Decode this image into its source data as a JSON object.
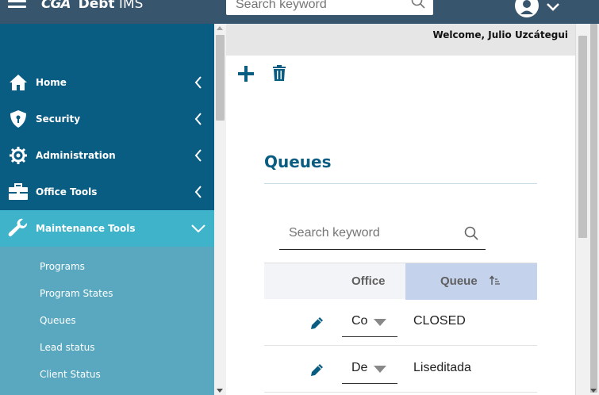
{
  "header": {
    "logo_mark": "CGA",
    "app_name_bold": "Debt",
    "app_name_light": " IMS",
    "search_placeholder": "Search keyword"
  },
  "welcome_text": "Welcome, Julio Uzcátegui",
  "sidebar": {
    "items": [
      {
        "label": "Home",
        "icon": "home-icon"
      },
      {
        "label": "Security",
        "icon": "shield-icon"
      },
      {
        "label": "Administration",
        "icon": "gear-icon"
      },
      {
        "label": "Office Tools",
        "icon": "toolbox-icon"
      },
      {
        "label": "Maintenance Tools",
        "icon": "wrench-icon",
        "expanded": true
      }
    ],
    "submenu": [
      "Programs",
      "Program States",
      "Queues",
      "Lead status",
      "Client Status"
    ]
  },
  "page": {
    "title": "Queues",
    "search_placeholder": "Search keyword",
    "columns": {
      "office": "Office",
      "queue": "Queue"
    },
    "rows": [
      {
        "office": "Co",
        "queue": "CLOSED"
      },
      {
        "office": "De",
        "queue": "Liseditada"
      }
    ]
  },
  "colors": {
    "topbar": "#38556e",
    "sidebar": "#0a5d82",
    "sidebar_active": "#3fb3ca",
    "submenu": "#59a8c0",
    "accent": "#0a5d82",
    "sorted_column": "#c5d2ec"
  }
}
